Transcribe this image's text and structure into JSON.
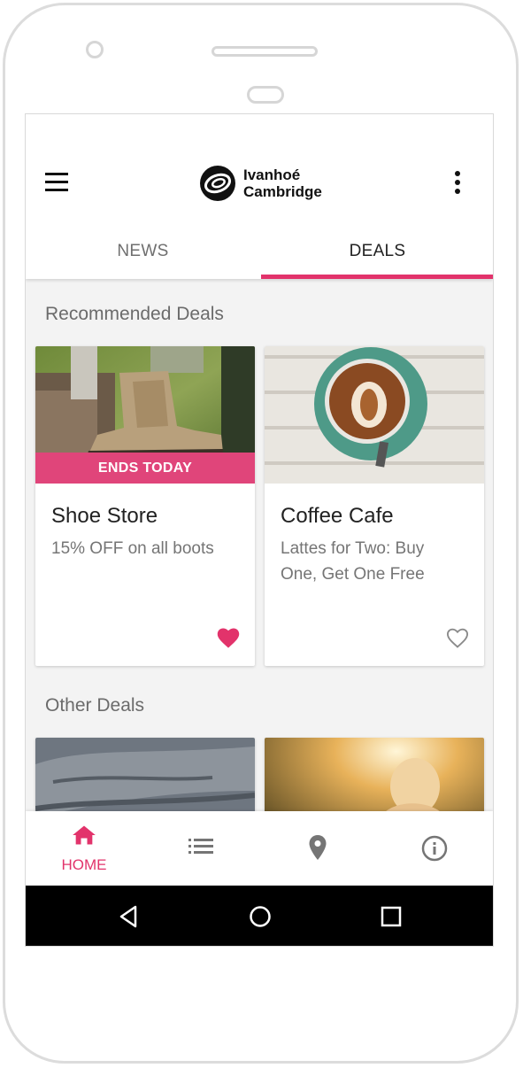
{
  "app": {
    "logo_line1": "Ivanhoé",
    "logo_line2": "Cambridge",
    "accent_color": "#e2336b"
  },
  "tabs": [
    {
      "label": "NEWS",
      "active": false
    },
    {
      "label": "DEALS",
      "active": true
    }
  ],
  "recommended": {
    "title": "Recommended Deals",
    "cards": [
      {
        "title": "Shoe Store",
        "description": "15% OFF on all boots",
        "badge": "ENDS TODAY",
        "image": "boots-photo",
        "favorited": true,
        "icon": "heart-filled-icon"
      },
      {
        "title": "Coffee Cafe",
        "description": "Lattes for Two: Buy One, Get One Free",
        "image": "latte-photo",
        "favorited": false,
        "icon": "heart-outline-icon"
      }
    ]
  },
  "other": {
    "title": "Other Deals",
    "cards": [
      {
        "image": "denim-photo"
      },
      {
        "image": "sunset-woman-photo"
      }
    ]
  },
  "bottom_nav": [
    {
      "label": "HOME",
      "icon": "home-icon",
      "active": true
    },
    {
      "label": "",
      "icon": "list-icon",
      "active": false
    },
    {
      "label": "",
      "icon": "location-pin-icon",
      "active": false
    },
    {
      "label": "",
      "icon": "info-icon",
      "active": false
    }
  ],
  "system_nav": [
    "back-icon",
    "home-circle-icon",
    "recents-icon"
  ]
}
